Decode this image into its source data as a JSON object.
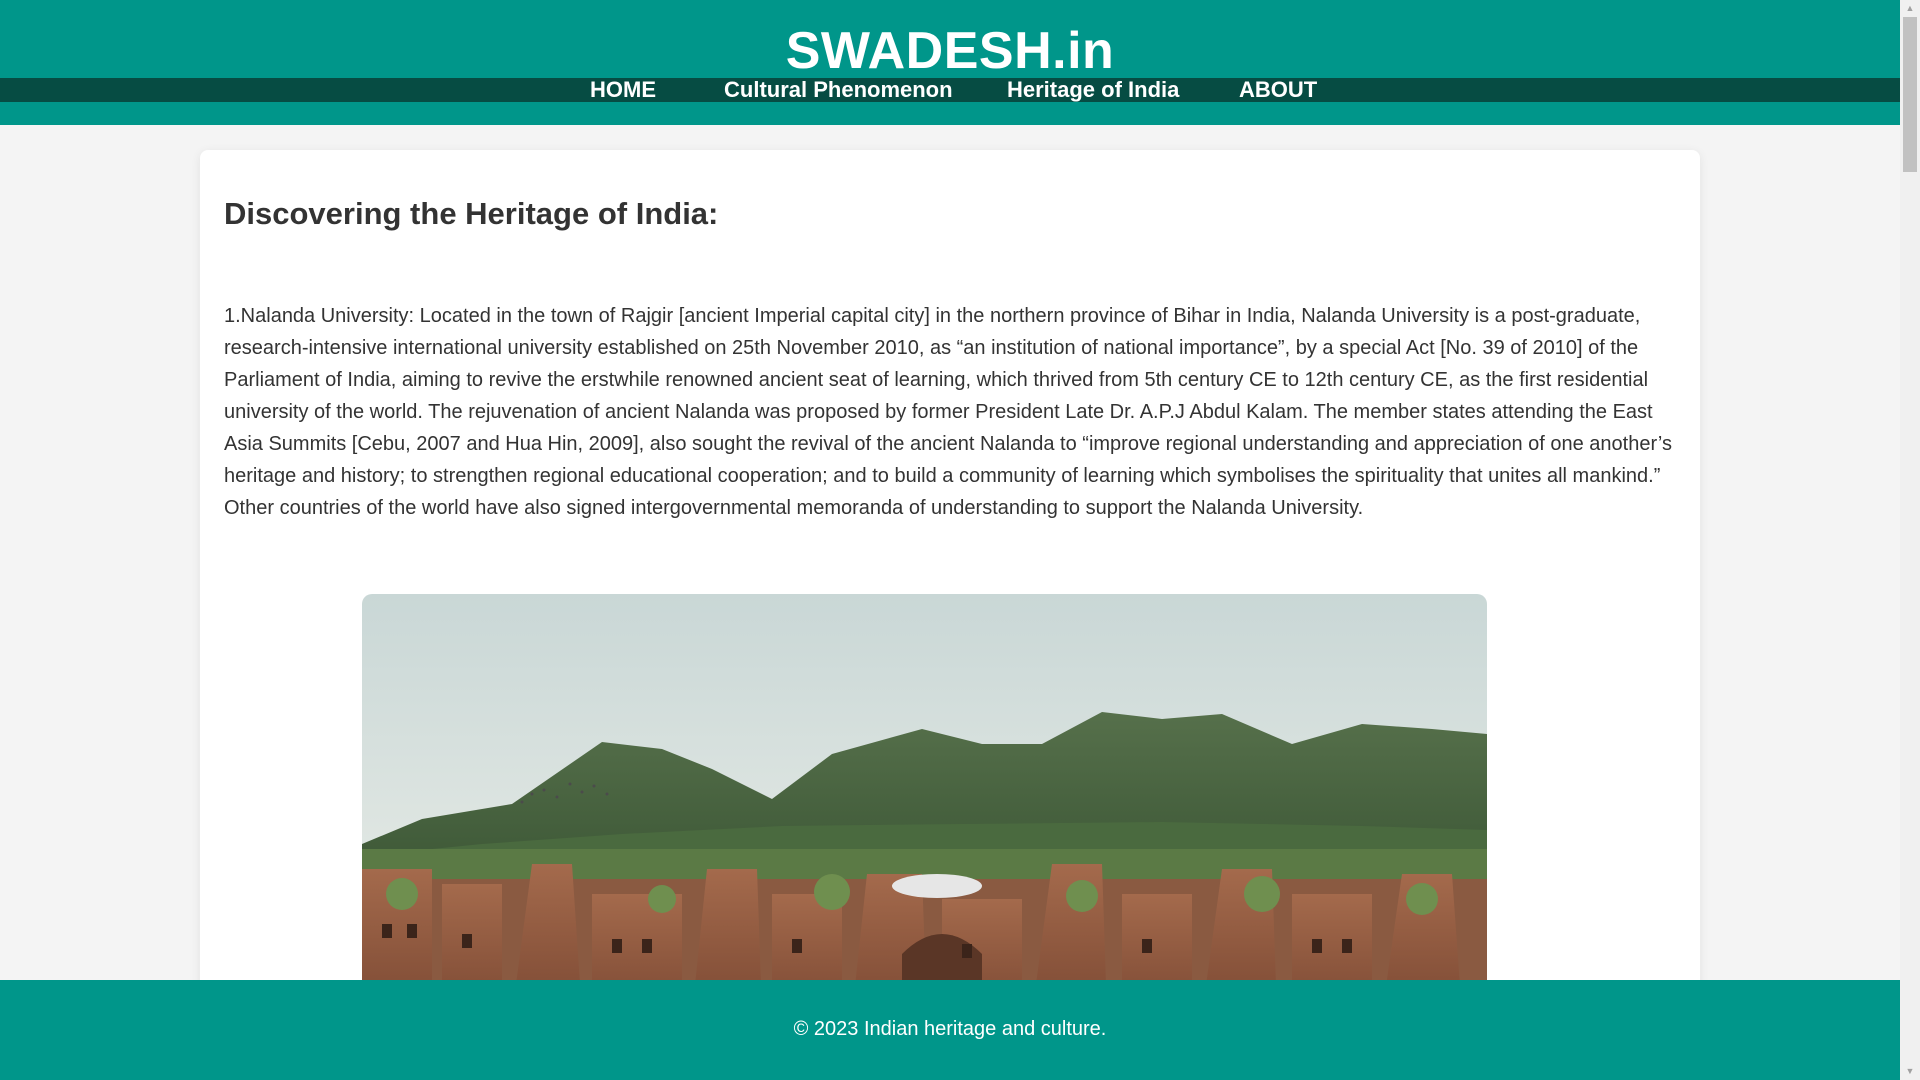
{
  "header": {
    "brand": "SWADESH.in",
    "nav": [
      "HOME",
      "Cultural Phenomenon",
      "Heritage of India",
      "ABOUT"
    ]
  },
  "main": {
    "title": "Discovering the Heritage of India:",
    "paragraph": "1.Nalanda University: Located in the town of Rajgir [ancient Imperial capital city] in the northern province of Bihar in India, Nalanda University is a post-graduate, research-intensive international university established on 25th November 2010, as “an institution of national importance”, by a special Act [No. 39 of 2010] of the Parliament of India, aiming to revive the erstwhile renowned ancient seat of learning, which thrived from 5th century CE to 12th century CE, as the first residential university of the world. The rejuvenation of ancient Nalanda was proposed by former President Late Dr. A.P.J Abdul Kalam. The member states attending the East Asia Summits [Cebu, 2007 and Hua Hin, 2009], also sought the revival of the ancient Nalanda to “improve regional understanding and appreciation of one another’s heritage and history; to strengthen regional educational cooperation; and to build a community of learning which symbolises the spirituality that unites all mankind.” Other countries of the world have also signed intergovernmental memoranda of understanding to support the Nalanda University."
  },
  "footer": {
    "text": "© 2023 Indian heritage and culture."
  },
  "colors": {
    "header": "#00968a",
    "navbar": "#064c43",
    "footer": "#00968a"
  }
}
